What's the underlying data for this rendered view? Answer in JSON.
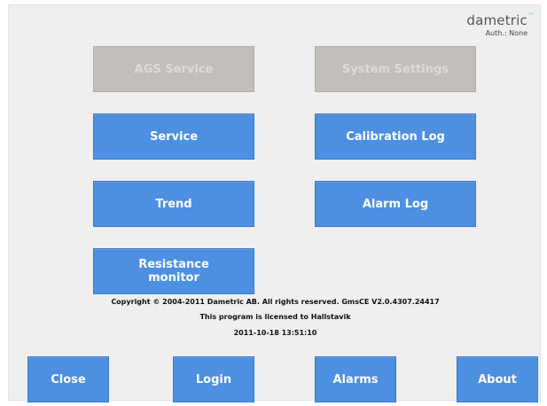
{
  "header": {
    "brand": "dametric",
    "auth": "Auth.: None"
  },
  "menu": {
    "ags_service": "AGS Service",
    "system_settings": "System Settings",
    "service": "Service",
    "calibration_log": "Calibration Log",
    "trend": "Trend",
    "alarm_log": "Alarm Log",
    "resistance_monitor": "Resistance\nmonitor"
  },
  "info": {
    "copyright": "Copyright © 2004-2011 Dametric AB.  All rights reserved.  GmsCE V2.0.4307.24417",
    "license": "This program is licensed to Hallstavik",
    "datetime": "2011-10-18 13:51:10"
  },
  "footer": {
    "close": "Close",
    "login": "Login",
    "alarms": "Alarms",
    "about": "About"
  },
  "colors": {
    "button_blue": "#4d8fe0",
    "button_disabled": "#c2bfbb",
    "background": "#efefef"
  }
}
